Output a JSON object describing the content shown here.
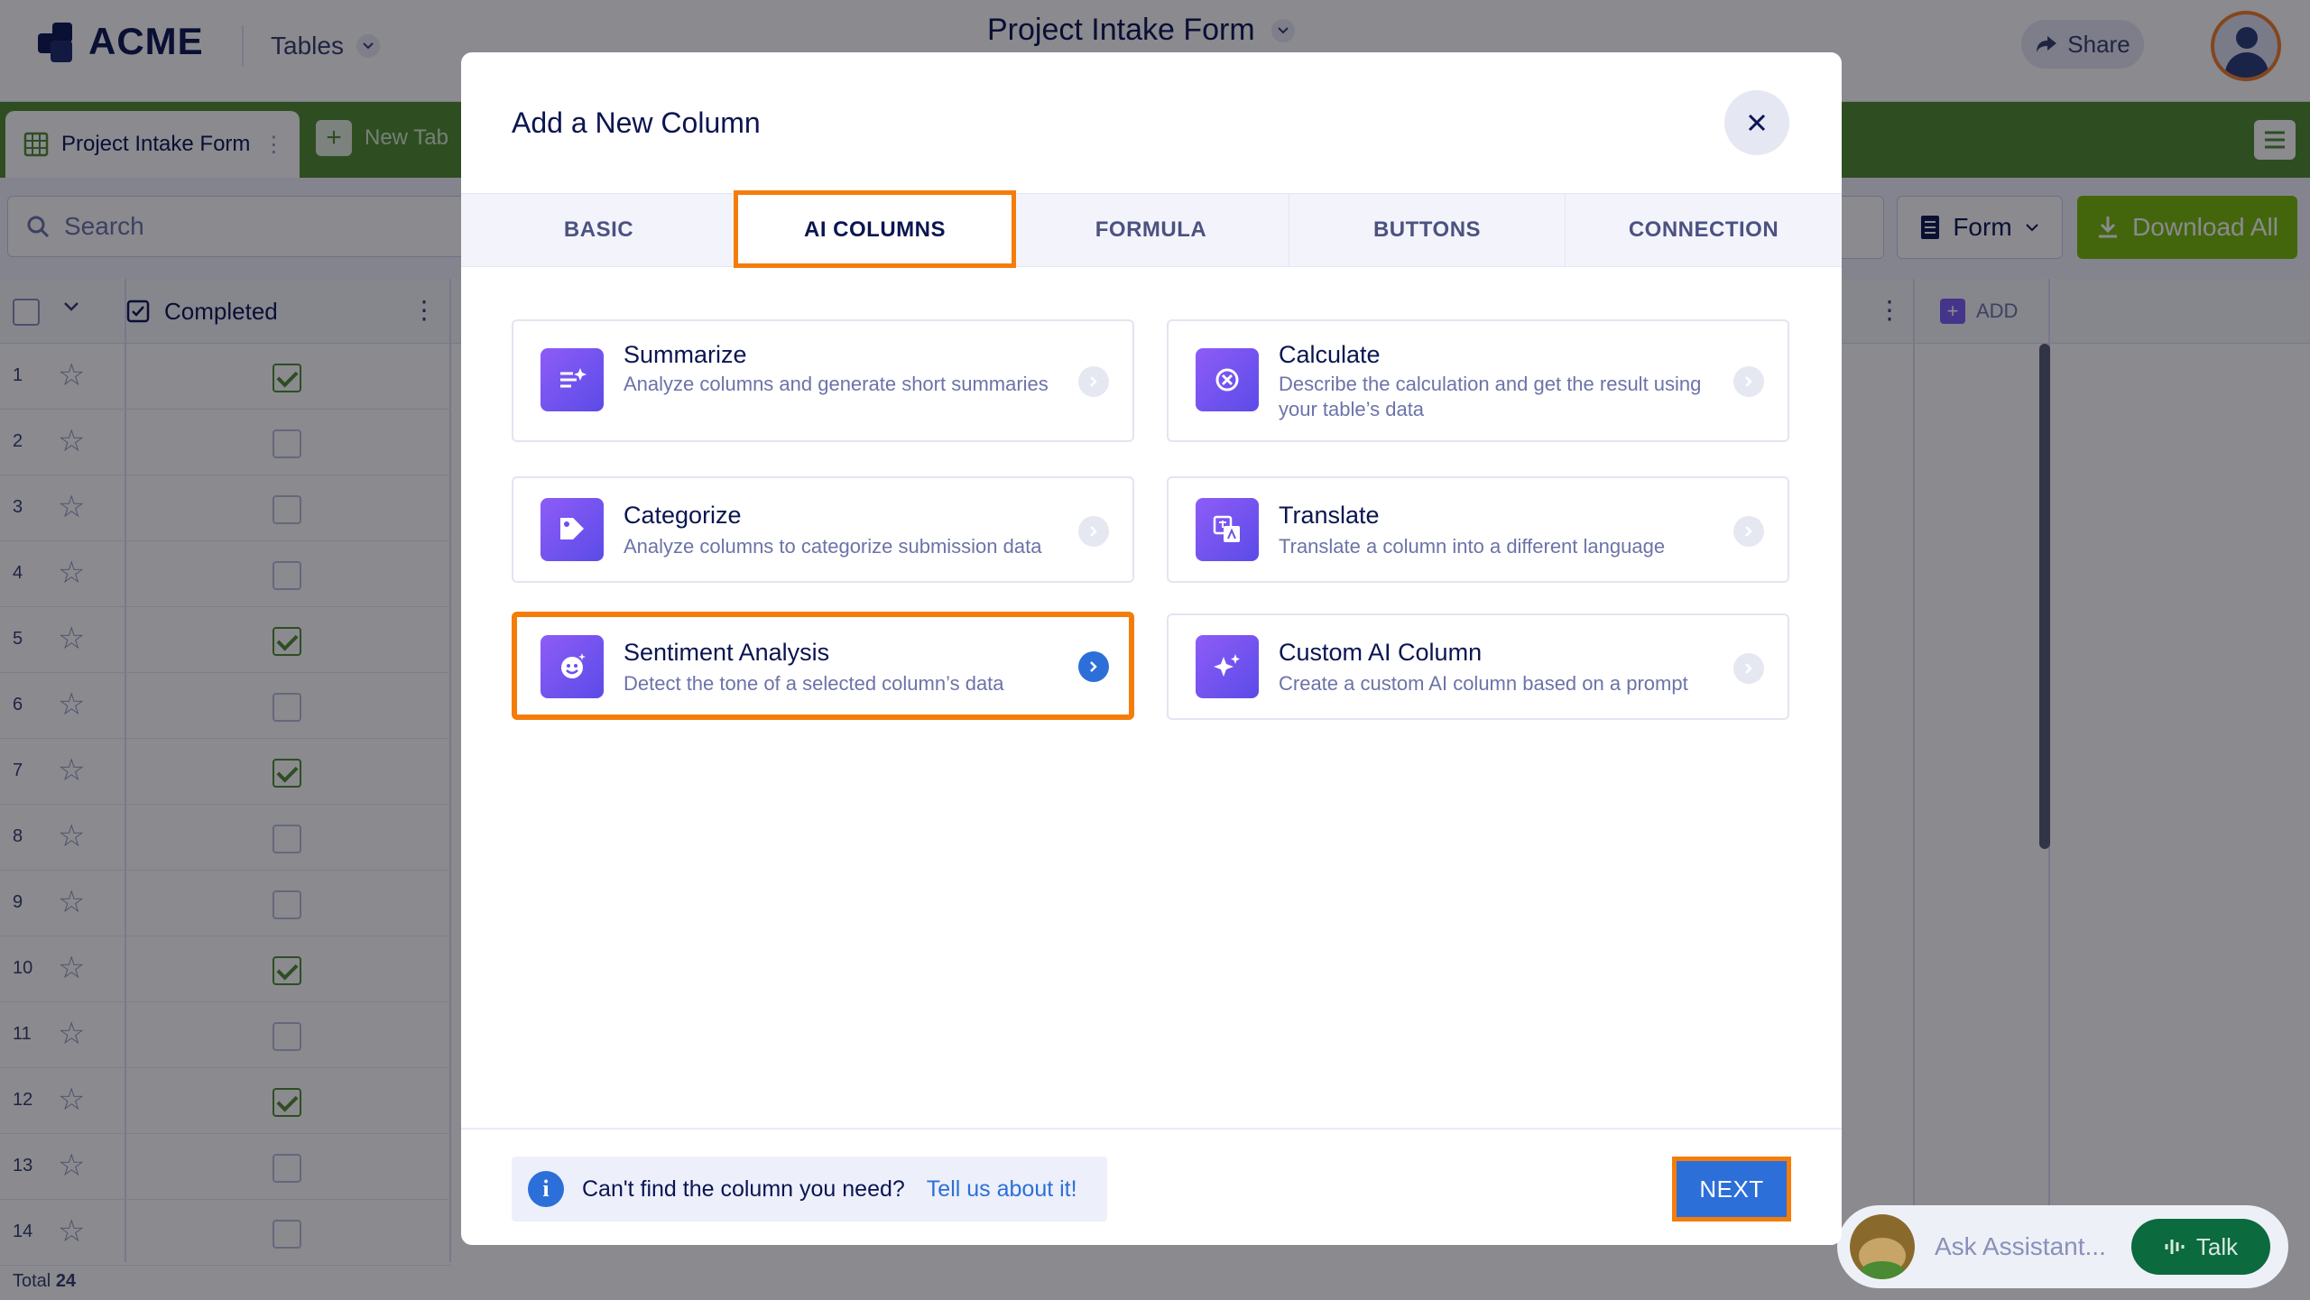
{
  "app": {
    "brand": "ACME",
    "nav_menu": "Tables",
    "project_title": "Project Intake Form",
    "share_label": "Share"
  },
  "tabs_bar": {
    "active_tab": "Project Intake Form",
    "new_tab": "New Tab"
  },
  "toolbar": {
    "search_placeholder": "Search",
    "view_label": "Form",
    "download_label": "Download All"
  },
  "table": {
    "column_completed": "Completed",
    "add_column": "ADD",
    "rows": [
      {
        "num": "1",
        "checked": true
      },
      {
        "num": "2",
        "checked": false
      },
      {
        "num": "3",
        "checked": false
      },
      {
        "num": "4",
        "checked": false
      },
      {
        "num": "5",
        "checked": true
      },
      {
        "num": "6",
        "checked": false
      },
      {
        "num": "7",
        "checked": true
      },
      {
        "num": "8",
        "checked": false
      },
      {
        "num": "9",
        "checked": false
      },
      {
        "num": "10",
        "checked": true
      },
      {
        "num": "11",
        "checked": false
      },
      {
        "num": "12",
        "checked": true
      },
      {
        "num": "13",
        "checked": false
      },
      {
        "num": "14",
        "checked": false
      }
    ],
    "total_label": "Total",
    "total_count": "24"
  },
  "modal": {
    "title": "Add a New Column",
    "tabs": [
      "BASIC",
      "AI COLUMNS",
      "FORMULA",
      "BUTTONS",
      "CONNECTION"
    ],
    "active_tab": "AI COLUMNS",
    "cards": [
      {
        "title": "Summarize",
        "description": "Analyze columns and generate short summaries",
        "icon": "summarize-icon"
      },
      {
        "title": "Calculate",
        "description": "Describe the calculation and get the result using your table’s data",
        "icon": "calculate-icon"
      },
      {
        "title": "Categorize",
        "description": "Analyze columns to categorize submission data",
        "icon": "categorize-icon"
      },
      {
        "title": "Translate",
        "description": "Translate a column into a different language",
        "icon": "translate-icon"
      },
      {
        "title": "Sentiment Analysis",
        "description": "Detect the tone of a selected column’s data",
        "icon": "sentiment-icon",
        "selected": true
      },
      {
        "title": "Custom AI Column",
        "description": "Create a custom AI column based on a prompt",
        "icon": "sparkle-icon"
      }
    ],
    "help_text": "Can't find the column you need?",
    "help_link": "Tell us about it!",
    "next_label": "NEXT"
  },
  "assistant": {
    "placeholder": "Ask Assistant...",
    "talk_label": "Talk"
  },
  "colors": {
    "accent_green": "#4f8d2f",
    "primary_blue": "#2d6fd8",
    "highlight_orange": "#f47d0a",
    "ai_purple": "#7b5cf5"
  }
}
